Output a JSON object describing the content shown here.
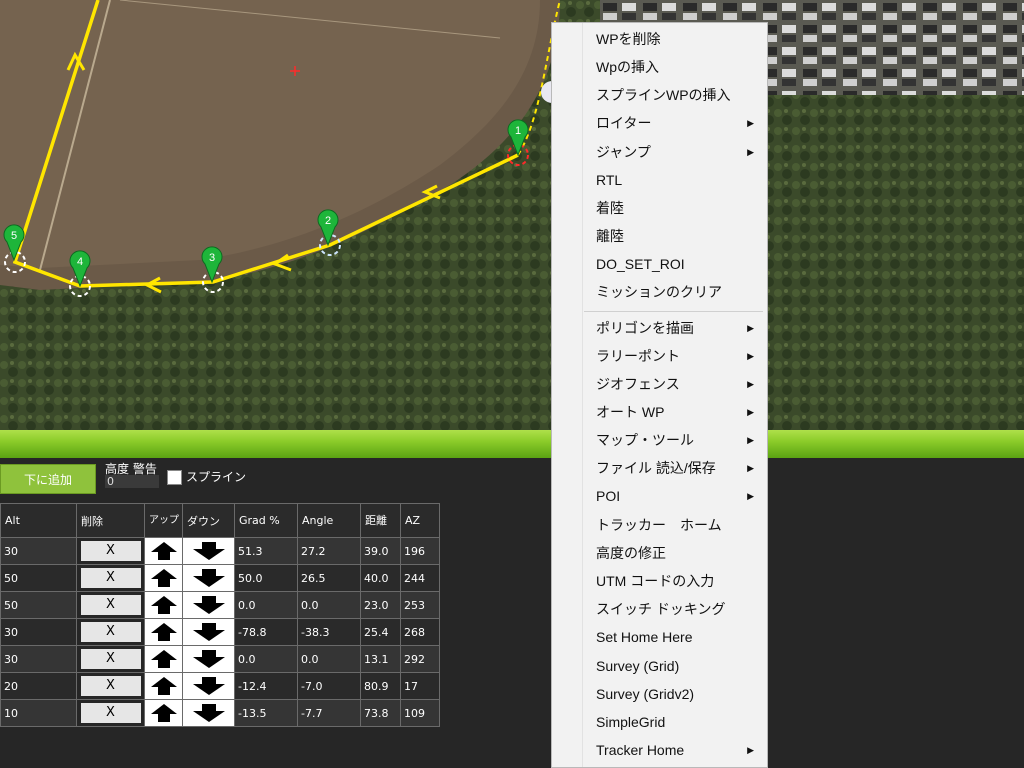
{
  "map": {
    "waypoints": [
      {
        "label": "1"
      },
      {
        "label": "2"
      },
      {
        "label": "3"
      },
      {
        "label": "4"
      },
      {
        "label": "5"
      }
    ]
  },
  "panel": {
    "add_below_label": "下に追加",
    "altitude_warning_label": "高度 警告",
    "altitude_warning_value": "0",
    "spline_label": "スプライン"
  },
  "table": {
    "headers": [
      "Alt",
      "削除",
      "アップ",
      "ダウン",
      "Grad %",
      "Angle",
      "距離",
      "AZ"
    ],
    "delete_symbol": "X",
    "rows": [
      {
        "alt": "30",
        "grad": "51.3",
        "angle": "27.2",
        "dist": "39.0",
        "az": "196"
      },
      {
        "alt": "50",
        "grad": "50.0",
        "angle": "26.5",
        "dist": "40.0",
        "az": "244"
      },
      {
        "alt": "50",
        "grad": "0.0",
        "angle": "0.0",
        "dist": "23.0",
        "az": "253"
      },
      {
        "alt": "30",
        "grad": "-78.8",
        "angle": "-38.3",
        "dist": "25.4",
        "az": "268"
      },
      {
        "alt": "30",
        "grad": "0.0",
        "angle": "0.0",
        "dist": "13.1",
        "az": "292"
      },
      {
        "alt": "20",
        "grad": "-12.4",
        "angle": "-7.0",
        "dist": "80.9",
        "az": "17"
      },
      {
        "alt": "10",
        "grad": "-13.5",
        "angle": "-7.7",
        "dist": "73.8",
        "az": "109"
      }
    ]
  },
  "menu": {
    "items": [
      {
        "label": "WPを削除",
        "submenu": false
      },
      {
        "label": "Wpの挿入",
        "submenu": false
      },
      {
        "label": "スプラインWPの挿入",
        "submenu": false
      },
      {
        "label": "ロイター",
        "submenu": true
      },
      {
        "label": "ジャンプ",
        "submenu": true
      },
      {
        "label": "RTL",
        "submenu": false
      },
      {
        "label": "着陸",
        "submenu": false
      },
      {
        "label": "離陸",
        "submenu": false
      },
      {
        "label": "DO_SET_ROI",
        "submenu": false
      },
      {
        "label": "ミッションのクリア",
        "submenu": false
      },
      {
        "label": "ポリゴンを描画",
        "submenu": true
      },
      {
        "label": "ラリーポント",
        "submenu": true
      },
      {
        "label": "ジオフェンス",
        "submenu": true
      },
      {
        "label": "オート WP",
        "submenu": true
      },
      {
        "label": "マップ・ツール",
        "submenu": true
      },
      {
        "label": "ファイル 読込/保存",
        "submenu": true
      },
      {
        "label": "POI",
        "submenu": true
      },
      {
        "label": "トラッカー　ホーム",
        "submenu": false
      },
      {
        "label": "高度の修正",
        "submenu": false
      },
      {
        "label": "UTM コードの入力",
        "submenu": false
      },
      {
        "label": "スイッチ ドッキング",
        "submenu": false
      },
      {
        "label": "Set Home Here",
        "submenu": false
      },
      {
        "label": "Survey (Grid)",
        "submenu": false
      },
      {
        "label": "Survey (Gridv2)",
        "submenu": false
      },
      {
        "label": "SimpleGrid",
        "submenu": false
      },
      {
        "label": "Tracker Home",
        "submenu": true
      }
    ]
  },
  "colors": {
    "route": "#ffe600",
    "waypoint_marker": "#1eb53a",
    "accent_green": "#8fc23c"
  }
}
